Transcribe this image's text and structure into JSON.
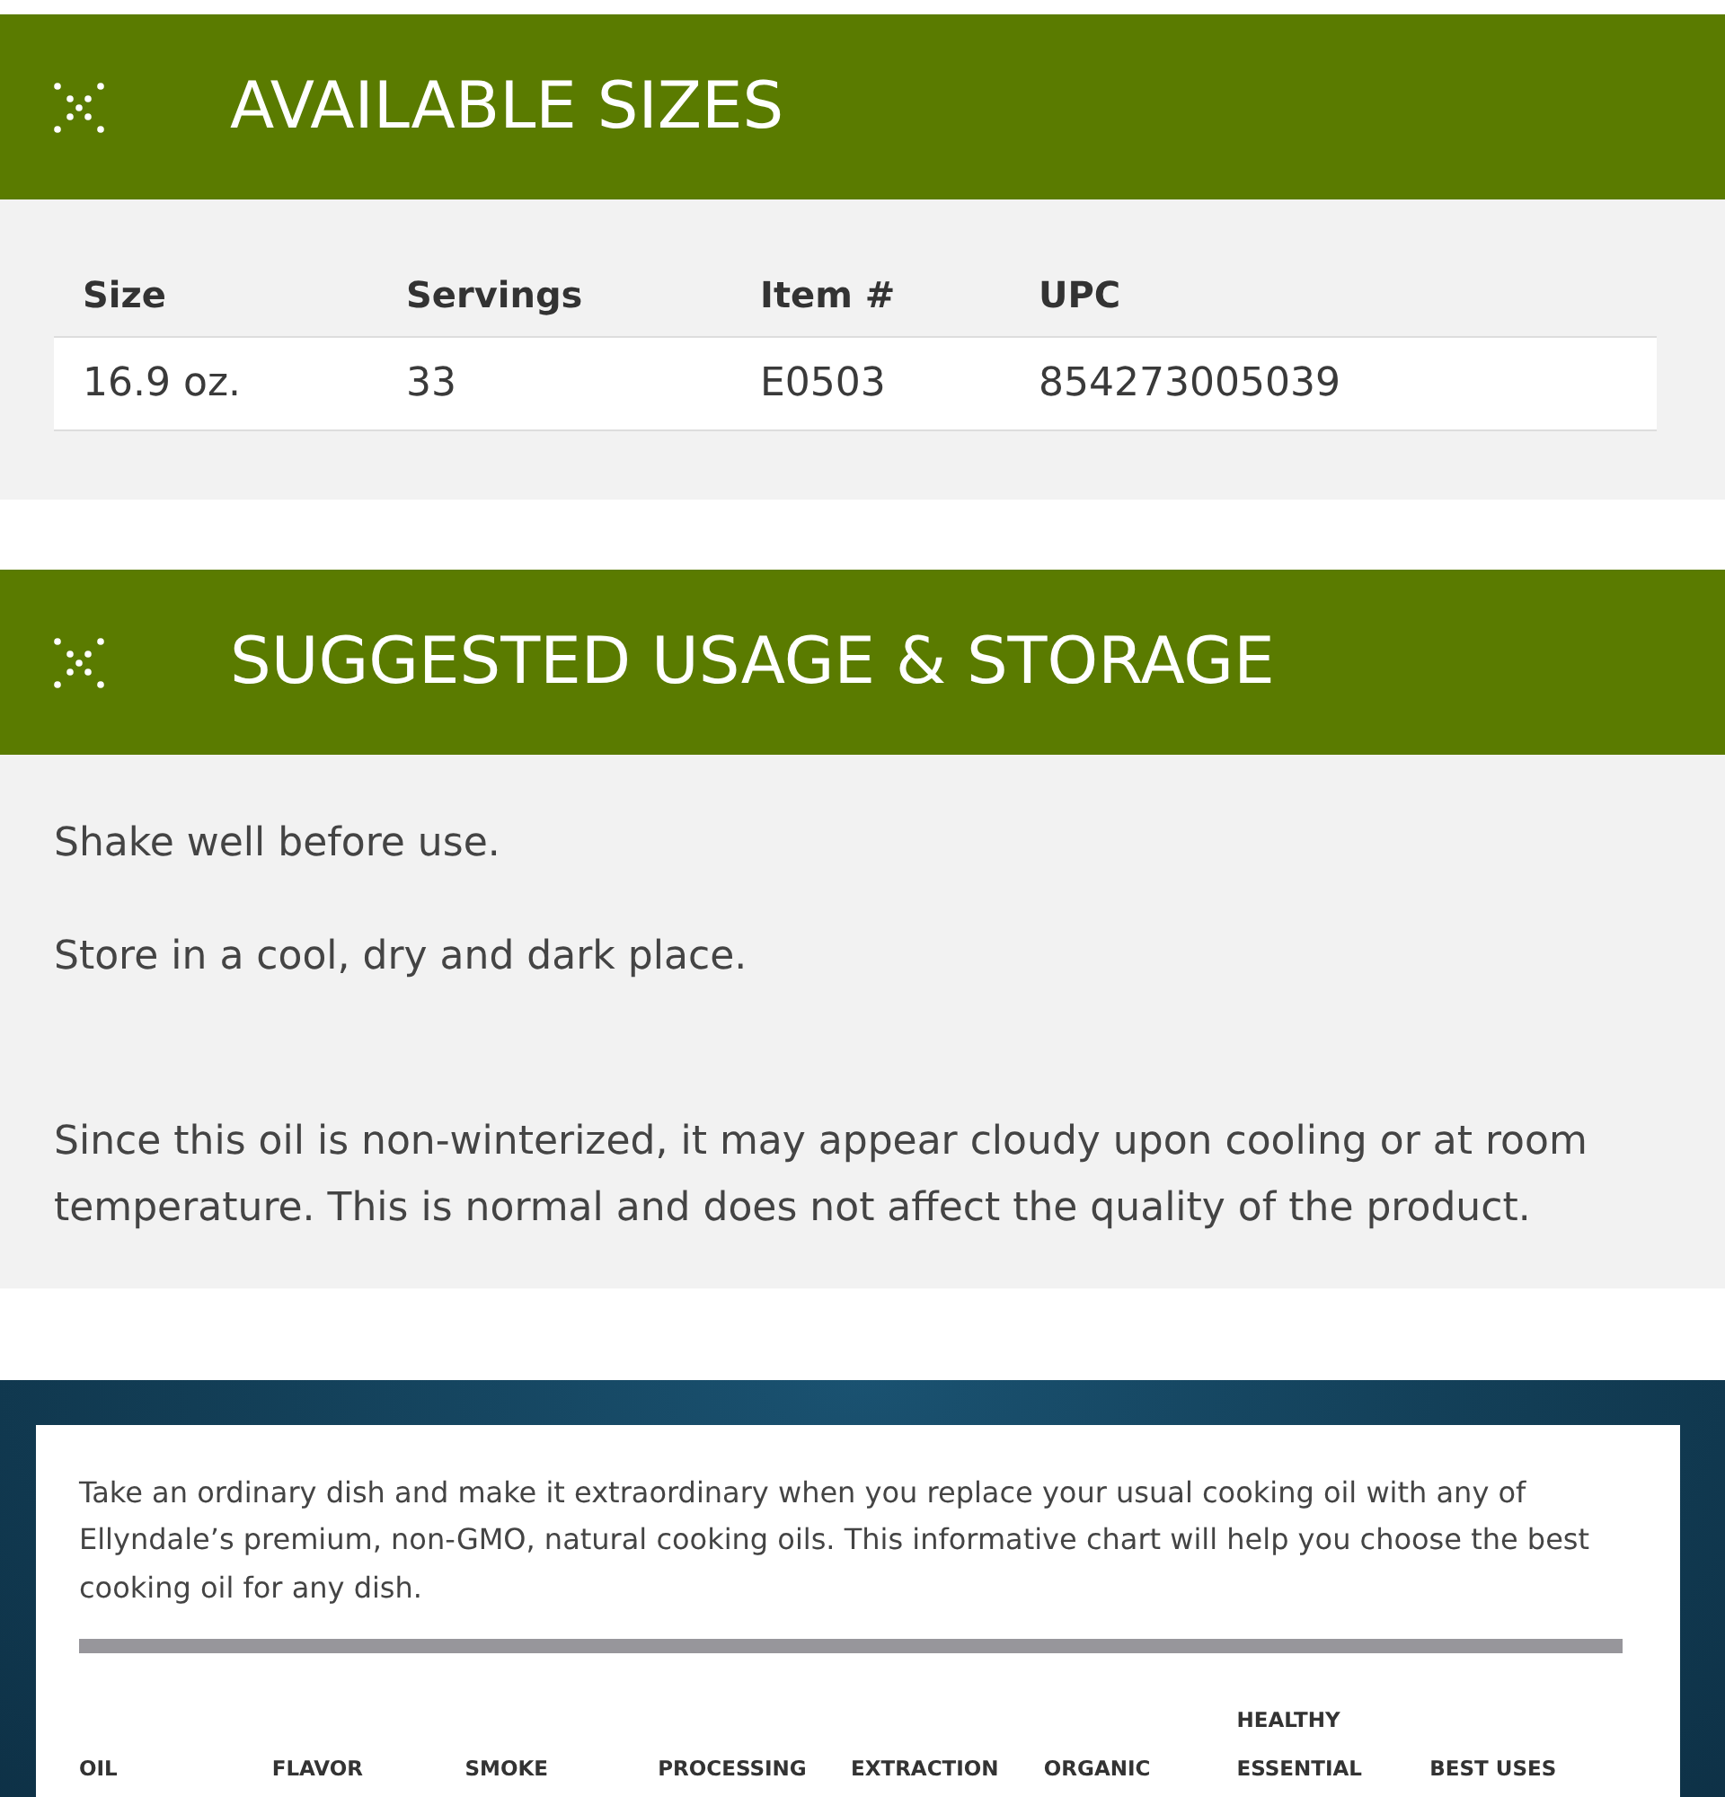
{
  "sections": [
    {
      "kind": "table",
      "title": "AVAILABLE SIZES",
      "table": {
        "columns": [
          "Size",
          "Servings",
          "Item #",
          "UPC"
        ],
        "rows": [
          [
            "16.9 oz.",
            "33",
            "E0503",
            "854273005039"
          ]
        ]
      }
    },
    {
      "kind": "text",
      "title": "SUGGESTED USAGE & STORAGE",
      "instructions": [
        "Shake well before use.",
        "Store in a cool, dry and dark place."
      ],
      "note": "Since this oil is non-winterized, it may appear cloudy upon cooling or at room temperature. This is normal and does not affect the quality of the product."
    }
  ],
  "comparison_table": {
    "intro": "Take an ordinary dish and make it extraordinary when you replace your usual cooking oil with any of Ellyndale’s premium, non-GMO, natural cooking oils. This informative chart will help you choose the best cooking oil for any dish.",
    "columns": [
      "OIL",
      "FLAVOR",
      "SMOKE",
      "PROCESSING",
      "EXTRACTION",
      "ORGANIC",
      "HEALTHY ESSENTIAL",
      "BEST USES"
    ]
  }
}
